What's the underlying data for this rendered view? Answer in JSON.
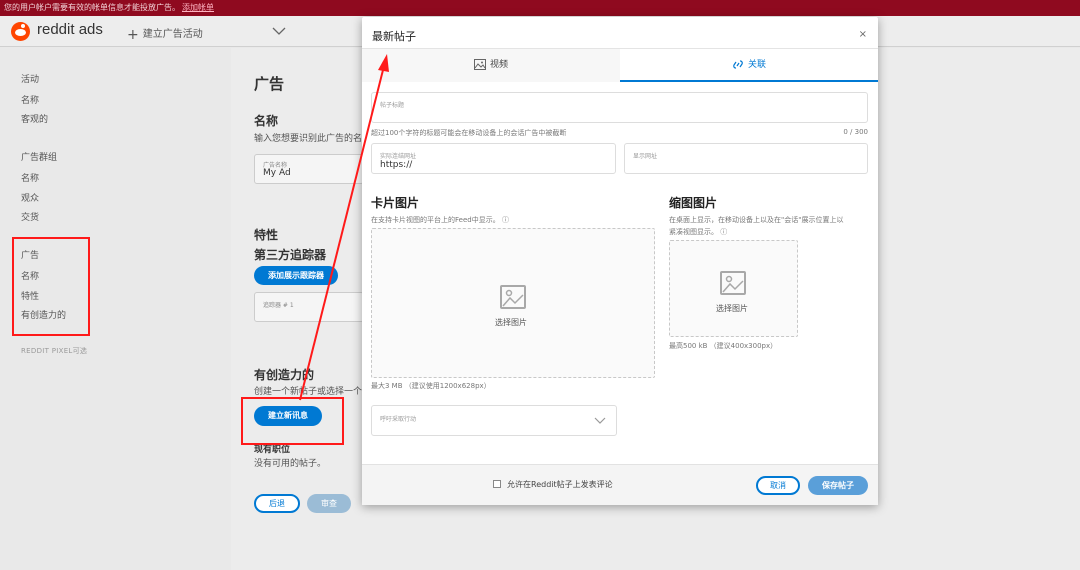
{
  "banner": {
    "text": "您的用户帐户需要有效的帐单信息才能投放广告。",
    "link": "添加帐单"
  },
  "header": {
    "logo_text": "reddit ads",
    "create_campaign": "建立广告活动"
  },
  "sidebar": {
    "groups": [
      {
        "heading": "活动",
        "items": [
          "名称",
          "客观的"
        ]
      },
      {
        "heading": "广告群组",
        "items": [
          "名称",
          "观众",
          "交货"
        ]
      },
      {
        "heading": "广告",
        "items": [
          "名称",
          "特性",
          "有创造力的"
        ]
      }
    ],
    "pixel_label": "REDDIT PIXEL可选"
  },
  "main": {
    "title": "广告",
    "name_heading": "名称",
    "name_desc": "输入您想要识别此广告的名",
    "ad_name_label": "广告名称",
    "ad_name_value": "My Ad",
    "features_heading": "特性",
    "tracker_heading": "第三方追踪器",
    "add_tracker_button": "添加展示跟踪器",
    "tracker_field_label": "追踪器 # 1",
    "creative_heading": "有创造力的",
    "creative_desc": "创建一个新帖子或选择一个",
    "new_post_button": "建立新讯息",
    "existing_posts_heading": "现有职位",
    "no_posts_text": "没有可用的帖子。",
    "back_button": "后退",
    "review_button": "审查"
  },
  "modal": {
    "title": "最新帖子",
    "close": "×",
    "tabs": [
      {
        "label": "视频",
        "icon": "image-icon",
        "active": false
      },
      {
        "label": "关联",
        "icon": "link-icon",
        "active": true
      }
    ],
    "post_title_label": "帖子标题",
    "post_title_hint": "超过100个字符的标题可能会在移动设备上的会话广告中被截断",
    "post_title_counter": "0 / 300",
    "dest_url_label": "实际连结网址",
    "dest_url_value": "https://",
    "display_url_label": "显示网址",
    "card_image": {
      "heading": "卡片图片",
      "desc": "在支持卡片视图的平台上的Feed中显示。",
      "select_text": "选择图片",
      "limit_text": "最大3 MB （建议使用1200x628px）"
    },
    "thumb_image": {
      "heading": "缩图图片",
      "desc_line1": "在桌面上显示，在移动设备上以及在\"会话\"展示位置上以",
      "desc_line2": "紧凑视图显示。",
      "select_text": "选择图片",
      "limit_text": "最高500 kB （建议400x300px）"
    },
    "cta_label": "呼吁采取行动",
    "footer": {
      "allow_comments_label": "允许在Reddit帖子上发表评论",
      "cancel_button": "取消",
      "save_button": "保存帖子"
    }
  },
  "colors": {
    "accent": "#0079d3",
    "banner": "#8f0a1f",
    "annotation": "#ff1a1a"
  }
}
